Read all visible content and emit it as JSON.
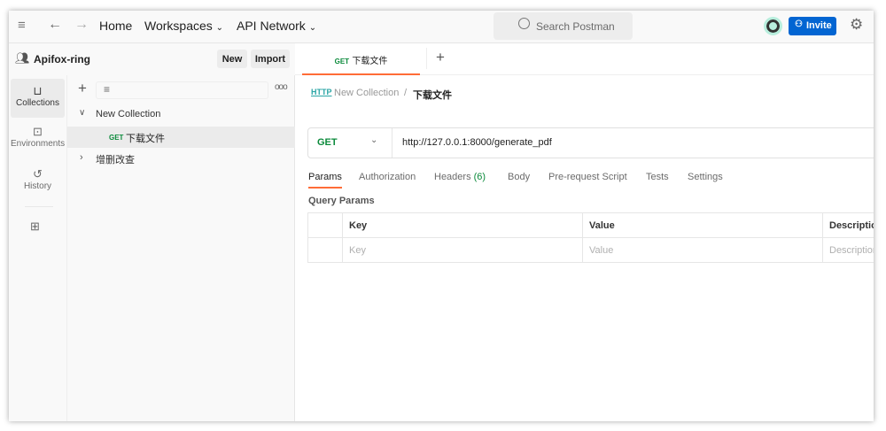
{
  "topbar": {
    "home": "Home",
    "workspaces": "Workspaces",
    "api_network": "API Network",
    "search_placeholder": "Search Postman",
    "invite": "Invite"
  },
  "workspace": {
    "name": "Apifox-ring",
    "new": "New",
    "import": "Import"
  },
  "rail": [
    {
      "label": "Collections",
      "icon": "collections-icon"
    },
    {
      "label": "Environments",
      "icon": "environments-icon"
    },
    {
      "label": "History",
      "icon": "history-icon"
    }
  ],
  "tree": {
    "collection": "New Collection",
    "request_method": "GET",
    "request_name": "下载文件",
    "folder": "增删改查"
  },
  "tab": {
    "method": "GET",
    "name": "下载文件"
  },
  "breadcrumb": {
    "collection": "New Collection",
    "sep": "/",
    "request": "下载文件"
  },
  "request": {
    "method": "GET",
    "url": "http://127.0.0.1:8000/generate_pdf"
  },
  "req_tabs": [
    {
      "label": "Params",
      "active": true
    },
    {
      "label": "Authorization"
    },
    {
      "label": "Headers",
      "count": "(6)"
    },
    {
      "label": "Body"
    },
    {
      "label": "Pre-request Script"
    },
    {
      "label": "Tests"
    },
    {
      "label": "Settings"
    }
  ],
  "params": {
    "title": "Query Params",
    "headers": [
      "Key",
      "Value",
      "Description"
    ],
    "placeholders": [
      "Key",
      "Value",
      "Description"
    ]
  },
  "colors": {
    "accent": "#ff6c37",
    "invite": "#0265d2",
    "get": "#0b8a3b"
  }
}
